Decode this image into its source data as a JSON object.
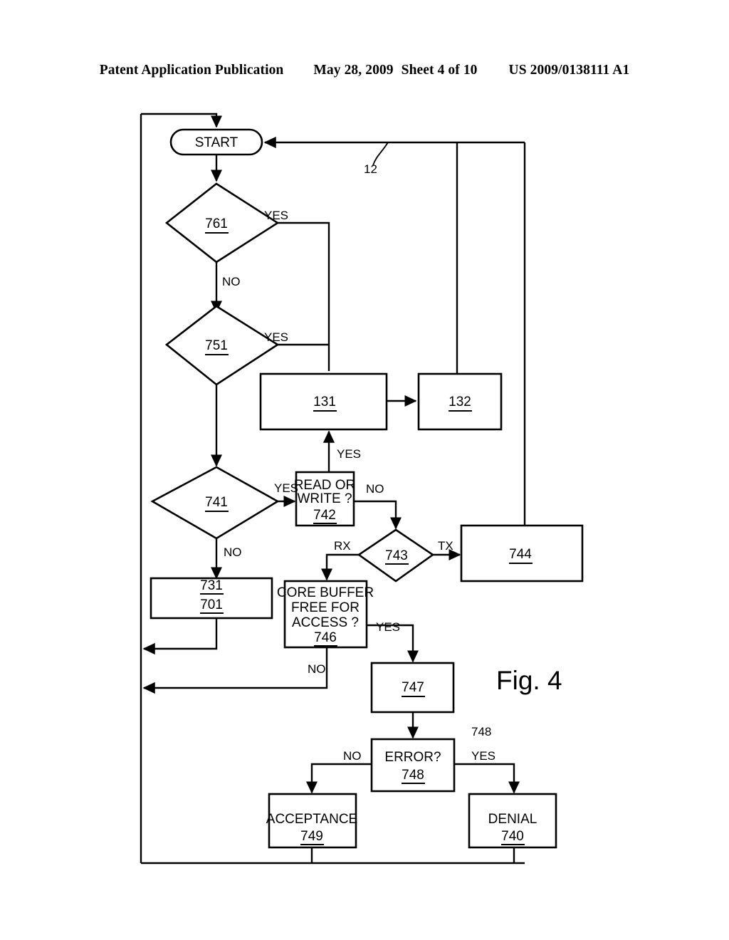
{
  "header": {
    "publication": "Patent Application Publication",
    "date": "May 28, 2009",
    "sheet": "Sheet 4 of 10",
    "document_number": "US 2009/0138111 A1"
  },
  "figure": {
    "caption": "Fig. 4",
    "loop_reference": "12",
    "error_reference": "748"
  },
  "nodes": {
    "start": {
      "label": "START"
    },
    "d761": {
      "ref": "761"
    },
    "d751": {
      "ref": "751"
    },
    "d741": {
      "ref": "741"
    },
    "b131": {
      "ref": "131"
    },
    "b132": {
      "ref": "132"
    },
    "b742": {
      "line1": "READ OR",
      "line2": "WRITE ?",
      "ref": "742"
    },
    "d743": {
      "ref": "743"
    },
    "b744": {
      "ref": "744"
    },
    "b731": {
      "ref1": "731",
      "ref2": "701"
    },
    "b746": {
      "line1": "CORE BUFFER",
      "line2": "FREE FOR",
      "line3": "ACCESS ?",
      "ref": "746"
    },
    "b747": {
      "ref": "747"
    },
    "b748": {
      "label": "ERROR?",
      "ref": "748"
    },
    "b749": {
      "label": "ACCEPTANCE",
      "ref": "749"
    },
    "b740": {
      "label": "DENIAL",
      "ref": "740"
    }
  },
  "edges": {
    "e761_yes": "YES",
    "e761_no": "NO",
    "e751_yes": "YES",
    "e741_yes": "YES",
    "e741_no": "NO",
    "e742_in_yes": "YES",
    "e742_no": "NO",
    "e743_rx": "RX",
    "e743_tx": "TX",
    "e746_yes": "YES",
    "e746_no": "NO",
    "e748_no": "NO",
    "e748_yes": "YES"
  },
  "colors": {
    "ink": "#000000",
    "paper": "#ffffff"
  }
}
